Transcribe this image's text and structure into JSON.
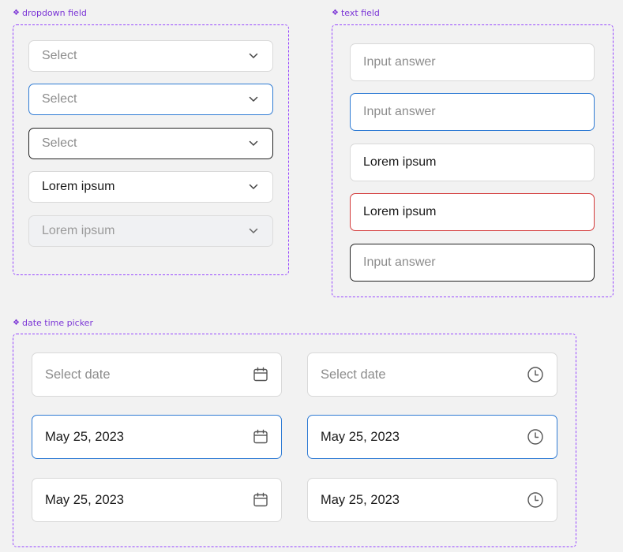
{
  "labels": {
    "dropdown": "dropdown field",
    "text": "text field",
    "datetime": "date time picker",
    "symbol": "❖"
  },
  "dropdown": {
    "items": [
      {
        "text": "Select"
      },
      {
        "text": "Select"
      },
      {
        "text": "Select"
      },
      {
        "text": "Lorem ipsum"
      },
      {
        "text": "Lorem ipsum"
      }
    ],
    "icon": "chevron-down-icon"
  },
  "textfield": {
    "items": [
      {
        "text": "Input answer"
      },
      {
        "text": "Input answer"
      },
      {
        "text": "Lorem ipsum"
      },
      {
        "text": "Lorem ipsum"
      },
      {
        "text": "Input answer"
      }
    ]
  },
  "datetime": {
    "date_items": [
      {
        "text": "Select date"
      },
      {
        "text": "May 25, 2023"
      },
      {
        "text": "May 25, 2023"
      }
    ],
    "time_items": [
      {
        "text": "Select date"
      },
      {
        "text": "May 25, 2023"
      },
      {
        "text": "May 25, 2023"
      }
    ],
    "date_icon": "calendar-icon",
    "time_icon": "clock-icon"
  },
  "colors": {
    "accent_purple": "#9747ff",
    "focus_blue": "#2f7bd4",
    "error_red": "#d33a3a"
  }
}
